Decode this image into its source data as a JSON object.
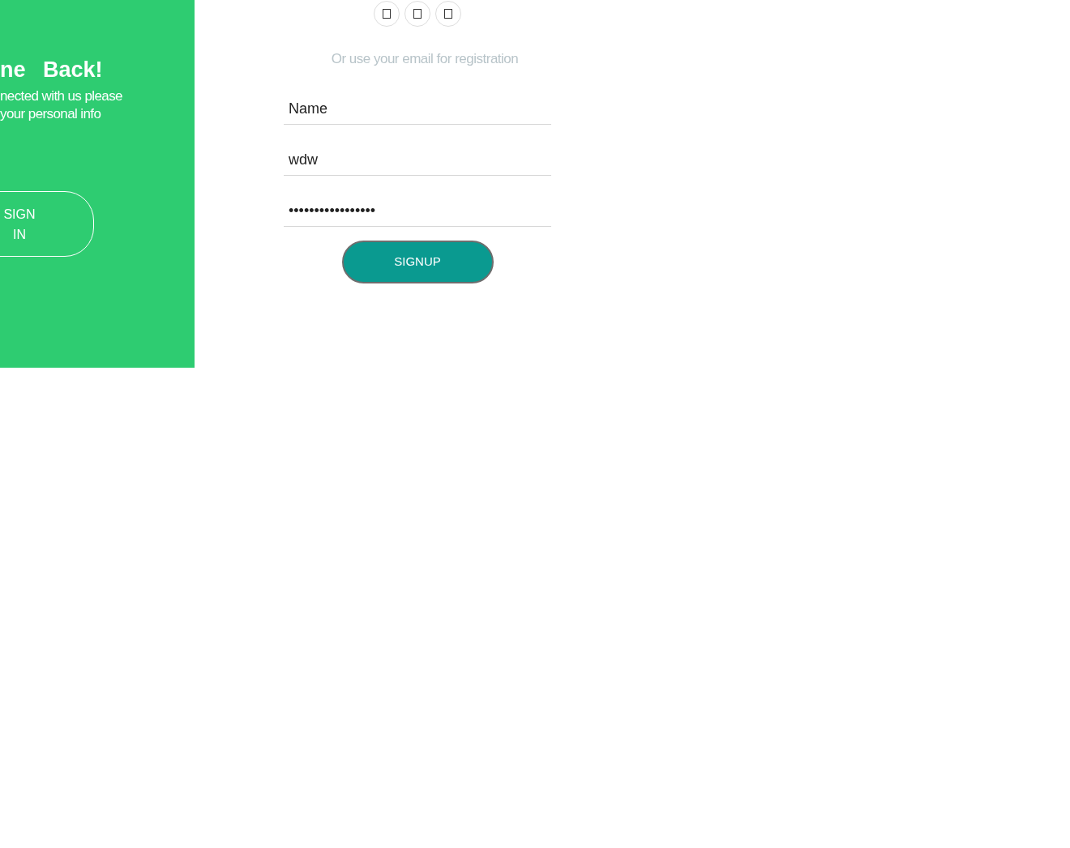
{
  "panel": {
    "heading": "ne Back!",
    "text": "nected with us please your personal info",
    "button": "SIGN IN"
  },
  "social_buttons": [
    {
      "kind": "square"
    },
    {
      "kind": "square"
    },
    {
      "kind": "square"
    }
  ],
  "hint": "Or use your email for registration",
  "fields": [
    {
      "value": "Name"
    },
    {
      "value": "wdw"
    },
    {
      "value": "•••••••••••••••••"
    }
  ],
  "submit": "SIGNUP"
}
